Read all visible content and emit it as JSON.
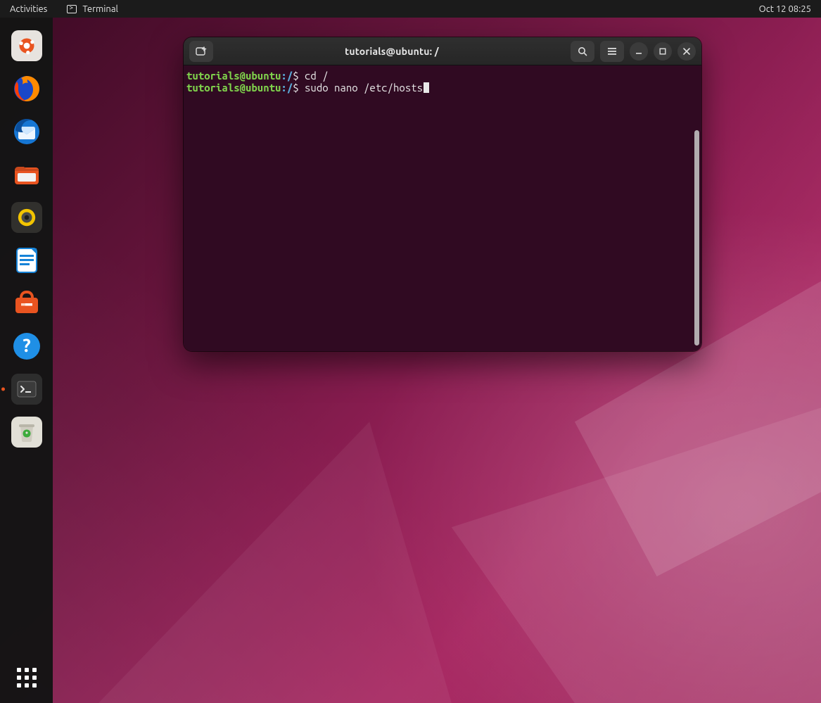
{
  "topbar": {
    "activities_label": "Activities",
    "app_label": "Terminal",
    "clock": "Oct 12  08:25"
  },
  "dock": {
    "items": [
      {
        "name": "ubiquity-installer",
        "bg": "#e2dedb"
      },
      {
        "name": "firefox",
        "bg": "transparent"
      },
      {
        "name": "thunderbird",
        "bg": "transparent"
      },
      {
        "name": "files-nautilus",
        "bg": "transparent"
      },
      {
        "name": "rhythmbox",
        "bg": "#3a3a3a"
      },
      {
        "name": "libreoffice-writer",
        "bg": "transparent"
      },
      {
        "name": "ubuntu-software",
        "bg": "transparent"
      },
      {
        "name": "help",
        "bg": "transparent"
      },
      {
        "name": "terminal",
        "bg": "#3a3a3a",
        "active": true
      },
      {
        "name": "trash",
        "bg": "#d9d6cf"
      }
    ],
    "show_apps_label": "Show Applications"
  },
  "terminal": {
    "title": "tutorials@ubuntu: /",
    "buttons": {
      "new_tab": "New Tab",
      "search": "Search",
      "menu": "Menu",
      "minimize": "Minimize",
      "maximize": "Maximize",
      "close": "Close"
    },
    "lines": [
      {
        "user": "tutorials@ubuntu",
        "sep": ":",
        "path": "/",
        "prompt": "$",
        "cmd": " cd /"
      },
      {
        "user": "tutorials@ubuntu",
        "sep": ":",
        "path": "/",
        "prompt": "$",
        "cmd": " sudo nano /etc/hosts",
        "cursor": true
      }
    ]
  }
}
